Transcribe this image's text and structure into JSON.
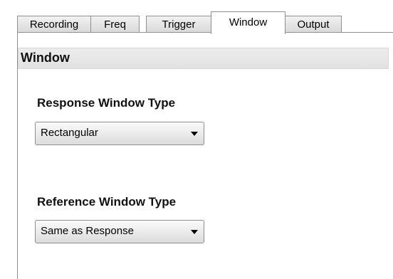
{
  "tabs": [
    {
      "label": "Recording",
      "active": false
    },
    {
      "label": "Freq",
      "active": false
    },
    {
      "label": "Trigger",
      "active": false
    },
    {
      "label": "Window",
      "active": true
    },
    {
      "label": "Output",
      "active": false
    }
  ],
  "section": {
    "title": "Window"
  },
  "response": {
    "label": "Response Window Type",
    "selected": "Rectangular"
  },
  "reference": {
    "label": "Reference Window Type",
    "selected": "Same as Response"
  }
}
